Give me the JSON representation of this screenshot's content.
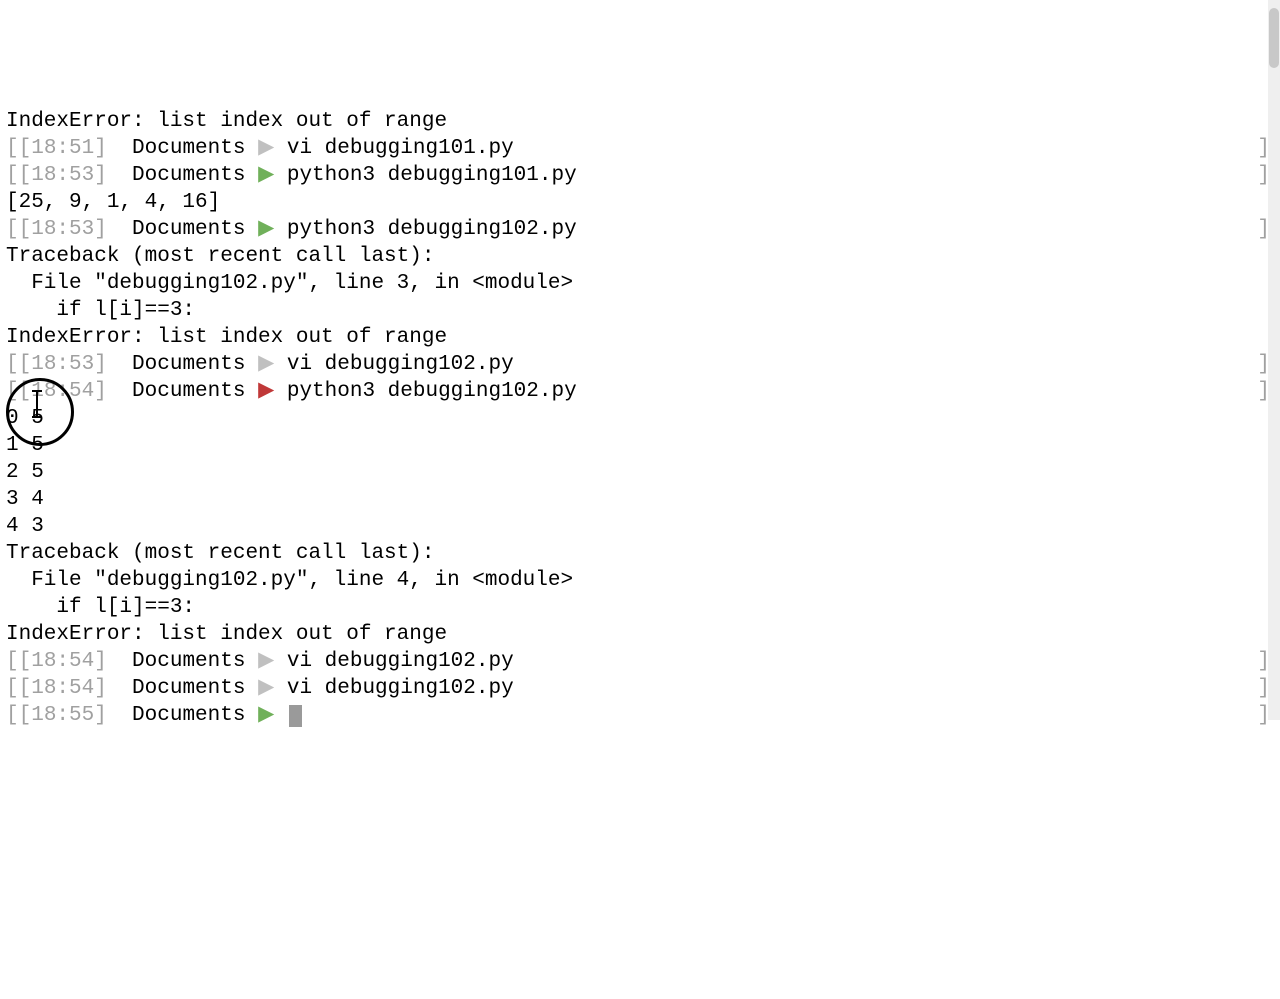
{
  "lines": [
    {
      "type": "output",
      "text": "IndexError: list index out of range"
    },
    {
      "type": "prompt",
      "time": "[18:51]",
      "dir": "Documents",
      "arrow": "grey",
      "cmd": "vi debugging101.py"
    },
    {
      "type": "prompt",
      "time": "[18:53]",
      "dir": "Documents",
      "arrow": "green",
      "cmd": "python3 debugging101.py"
    },
    {
      "type": "output",
      "text": "[25, 9, 1, 4, 16]"
    },
    {
      "type": "prompt",
      "time": "[18:53]",
      "dir": "Documents",
      "arrow": "green",
      "cmd": "python3 debugging102.py"
    },
    {
      "type": "output",
      "text": "Traceback (most recent call last):"
    },
    {
      "type": "output",
      "text": "  File \"debugging102.py\", line 3, in <module>"
    },
    {
      "type": "output",
      "text": "    if l[i]==3:"
    },
    {
      "type": "output",
      "text": "IndexError: list index out of range"
    },
    {
      "type": "prompt",
      "time": "[18:53]",
      "dir": "Documents",
      "arrow": "grey",
      "cmd": "vi debugging102.py"
    },
    {
      "type": "prompt",
      "time": "[18:54]",
      "dir": "Documents",
      "arrow": "red",
      "cmd": "python3 debugging102.py"
    },
    {
      "type": "output",
      "text": "0 5"
    },
    {
      "type": "output",
      "text": "1 5"
    },
    {
      "type": "output",
      "text": "2 5"
    },
    {
      "type": "output",
      "text": "3 4"
    },
    {
      "type": "output",
      "text": "4 3"
    },
    {
      "type": "output",
      "text": "Traceback (most recent call last):"
    },
    {
      "type": "output",
      "text": "  File \"debugging102.py\", line 4, in <module>"
    },
    {
      "type": "output",
      "text": "    if l[i]==3:"
    },
    {
      "type": "output",
      "text": "IndexError: list index out of range"
    },
    {
      "type": "prompt",
      "time": "[18:54]",
      "dir": "Documents",
      "arrow": "grey",
      "cmd": "vi debugging102.py"
    },
    {
      "type": "prompt",
      "time": "[18:54]",
      "dir": "Documents",
      "arrow": "grey",
      "cmd": "vi debugging102.py"
    },
    {
      "type": "prompt",
      "time": "[18:55]",
      "dir": "Documents",
      "arrow": "green",
      "cmd": "",
      "cursor": true
    }
  ],
  "right_bracket": "]",
  "left_bracket": "["
}
